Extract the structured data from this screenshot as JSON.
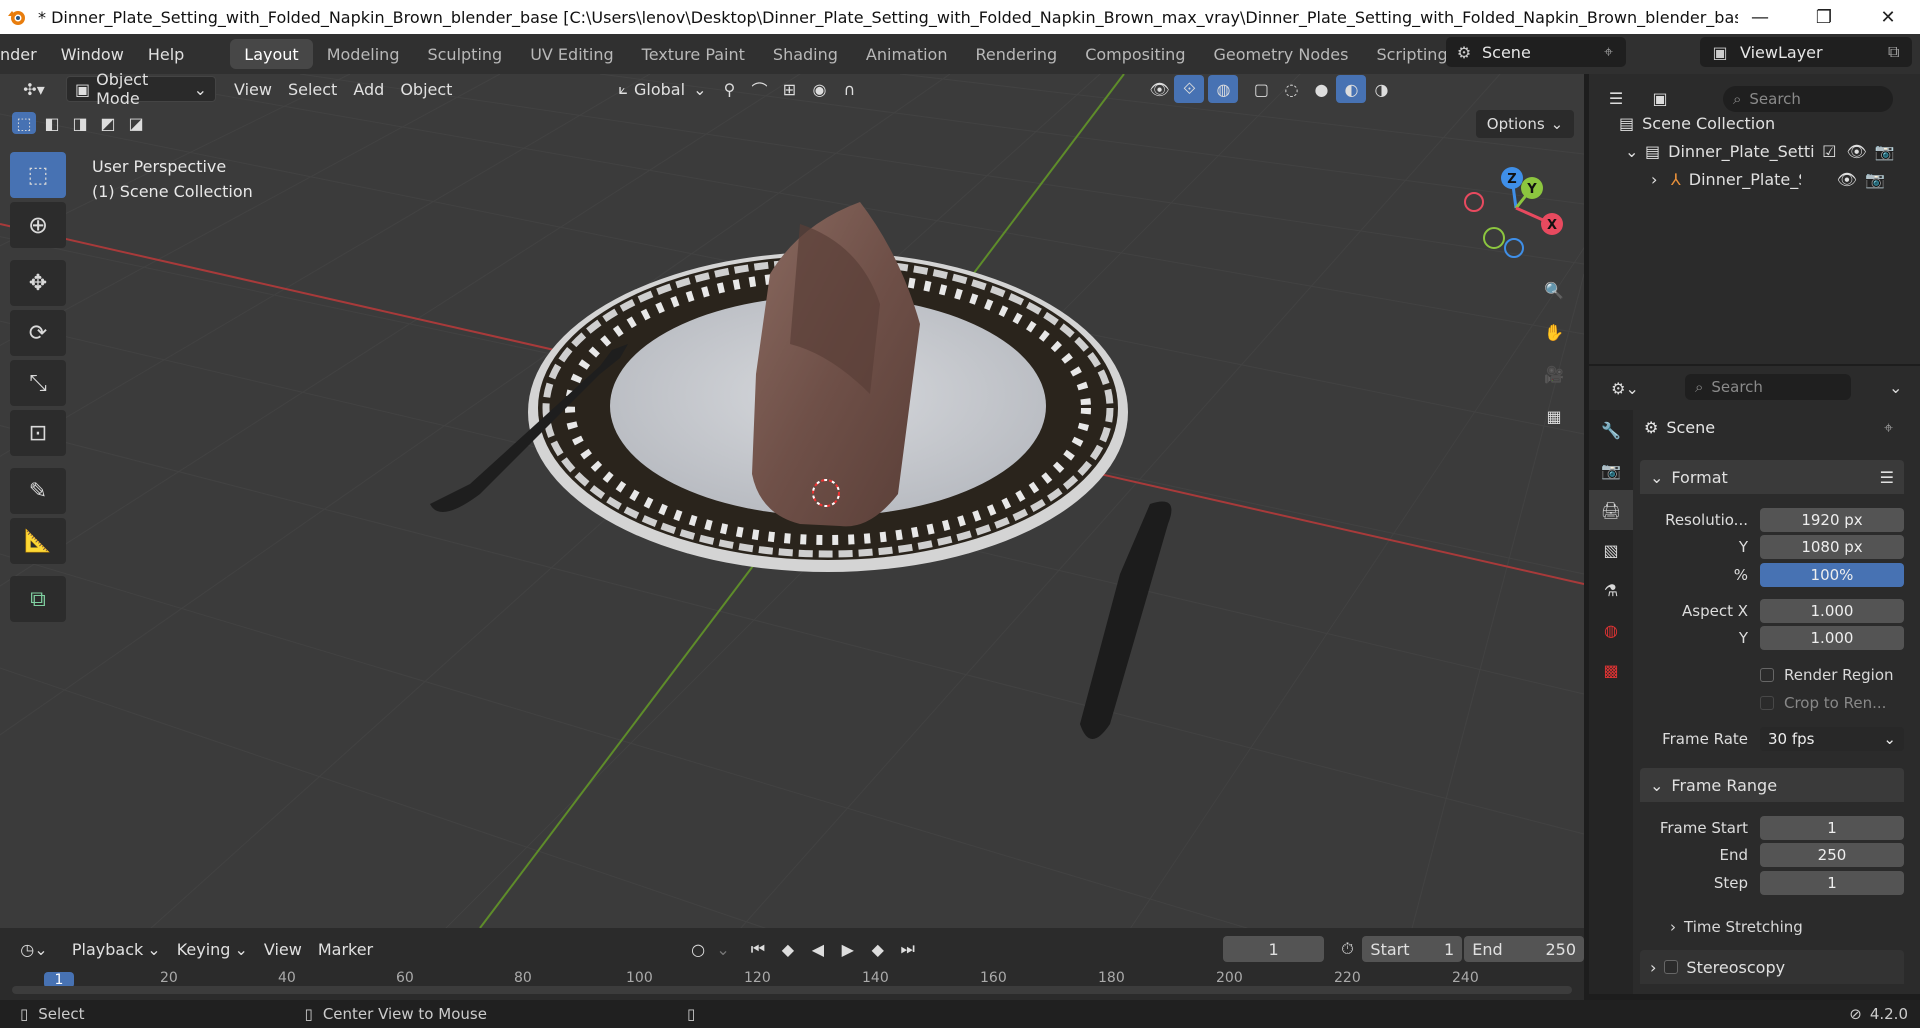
{
  "window": {
    "title": "* Dinner_Plate_Setting_with_Folded_Napkin_Brown_blender_base [C:\\Users\\lenov\\Desktop\\Dinner_Plate_Setting_with_Folded_Napkin_Brown_max_vray\\Dinner_Plate_Setting_with_Folded_Napkin_Brown_blender_base.blend] - B...",
    "min": "—",
    "restore": "❐",
    "close": "✕"
  },
  "menu": {
    "items": [
      "nder",
      "Window",
      "Help"
    ]
  },
  "workspaces": [
    "Layout",
    "Modeling",
    "Sculpting",
    "UV Editing",
    "Texture Paint",
    "Shading",
    "Animation",
    "Rendering",
    "Compositing",
    "Geometry Nodes",
    "Scripting"
  ],
  "active_workspace": "Layout",
  "scene": {
    "name": "Scene",
    "viewlayer": "ViewLayer"
  },
  "viewport": {
    "mode": "Object Mode",
    "menus": [
      "View",
      "Select",
      "Add",
      "Object"
    ],
    "orientation": "Global",
    "options": "Options",
    "info_line1": "User Perspective",
    "info_line2": "(1) Scene Collection",
    "gizmo": {
      "z": "Z",
      "y": "Y",
      "x": "X"
    }
  },
  "outliner": {
    "search_placeholder": "Search",
    "root": "Scene Collection",
    "collection": "Dinner_Plate_Settin",
    "object": "Dinner_Plate_Sc"
  },
  "properties": {
    "search_placeholder": "Search",
    "context": "Scene",
    "format": {
      "header": "Format",
      "res_x_label": "Resolutio...",
      "res_x": "1920 px",
      "res_y_label": "Y",
      "res_y": "1080 px",
      "pct_label": "%",
      "pct": "100%",
      "aspect_x_label": "Aspect X",
      "aspect_x": "1.000",
      "aspect_y_label": "Y",
      "aspect_y": "1.000",
      "render_region": "Render Region",
      "crop": "Crop to Ren...",
      "frame_rate_label": "Frame Rate",
      "frame_rate": "30 fps"
    },
    "frame_range": {
      "header": "Frame Range",
      "start_label": "Frame Start",
      "start": "1",
      "end_label": "End",
      "end": "250",
      "step_label": "Step",
      "step": "1",
      "time_stretching": "Time Stretching",
      "stereoscopy": "Stereoscopy"
    }
  },
  "timeline": {
    "menus": [
      "Playback",
      "Keying",
      "View",
      "Marker"
    ],
    "current_frame": "1",
    "start_label": "Start",
    "start": "1",
    "end_label": "End",
    "end": "250",
    "ruler": [
      "1",
      "20",
      "40",
      "60",
      "80",
      "100",
      "120",
      "140",
      "160",
      "180",
      "200",
      "220",
      "240"
    ]
  },
  "status": {
    "select": "Select",
    "center": "Center View to Mouse",
    "version": "4.2.0"
  },
  "colors": {
    "accent": "#4772b3",
    "x_axis": "#e84a5f",
    "y_axis": "#8cc63f",
    "z_axis": "#3f8fe8"
  }
}
